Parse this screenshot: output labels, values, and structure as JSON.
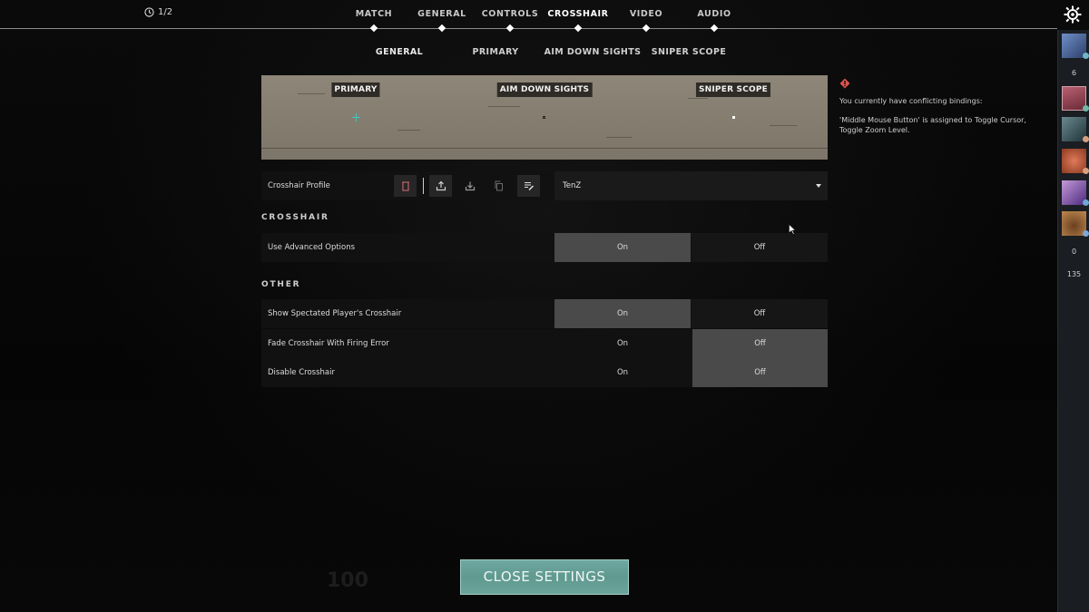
{
  "header": {
    "timer": "1/2",
    "main_tabs": [
      {
        "label": "MATCH",
        "active": false
      },
      {
        "label": "GENERAL",
        "active": false
      },
      {
        "label": "CONTROLS",
        "active": false
      },
      {
        "label": "CROSSHAIR",
        "active": true
      },
      {
        "label": "VIDEO",
        "active": false
      },
      {
        "label": "AUDIO",
        "active": false
      }
    ],
    "sub_tabs": [
      {
        "label": "GENERAL",
        "active": true
      },
      {
        "label": "PRIMARY",
        "active": false
      },
      {
        "label": "AIM DOWN SIGHTS",
        "active": false
      },
      {
        "label": "SNIPER SCOPE",
        "active": false
      }
    ]
  },
  "preview": {
    "labels": [
      "PRIMARY",
      "AIM DOWN SIGHTS",
      "SNIPER SCOPE"
    ],
    "primary_color": "#3fc6c0"
  },
  "warning": {
    "icon": "warning-diamond-icon",
    "title": "You currently have conflicting bindings:",
    "detail": "'Middle Mouse Button' is assigned to Toggle Cursor, Toggle Zoom Level."
  },
  "profile": {
    "label": "Crosshair Profile",
    "value": "TenZ",
    "actions": [
      "delete-icon",
      "export-icon",
      "import-icon",
      "copy-icon",
      "rename-icon"
    ]
  },
  "sections": [
    {
      "title": "CROSSHAIR",
      "rows": [
        {
          "label": "Use Advanced Options",
          "on": "On",
          "off": "Off",
          "selected": "on"
        }
      ]
    },
    {
      "title": "OTHER",
      "rows": [
        {
          "label": "Show Spectated Player's Crosshair",
          "on": "On",
          "off": "Off",
          "selected": "on"
        },
        {
          "label": "Fade Crosshair With Firing Error",
          "on": "On",
          "off": "Off",
          "selected": "off"
        },
        {
          "label": "Disable Crosshair",
          "on": "On",
          "off": "Off",
          "selected": "off"
        }
      ]
    }
  ],
  "sidebar": {
    "counts": [
      "6",
      "0",
      "135"
    ],
    "avatars": [
      {
        "name": "avatar-1",
        "color": "#4a6a9a",
        "status": "#6fb7c7"
      },
      {
        "name": "avatar-2",
        "color": "#9a5060",
        "status": "#6fb7a7"
      },
      {
        "name": "avatar-3",
        "color": "#3a5a60",
        "status": "#d6a080"
      },
      {
        "name": "avatar-4",
        "color": "#c0603a",
        "status": "#d6a080"
      },
      {
        "name": "avatar-5",
        "color": "#8a5ab0",
        "status": "#6fa7d7"
      },
      {
        "name": "avatar-6",
        "color": "#a0703a",
        "status": "#7fa7d7"
      }
    ]
  },
  "footer": {
    "close_label": "CLOSE SETTINGS",
    "ghost_hp": "100"
  },
  "colors": {
    "accent": "#64a39a",
    "selected_option": "#4a4a4a",
    "row_bg": "#111111"
  }
}
